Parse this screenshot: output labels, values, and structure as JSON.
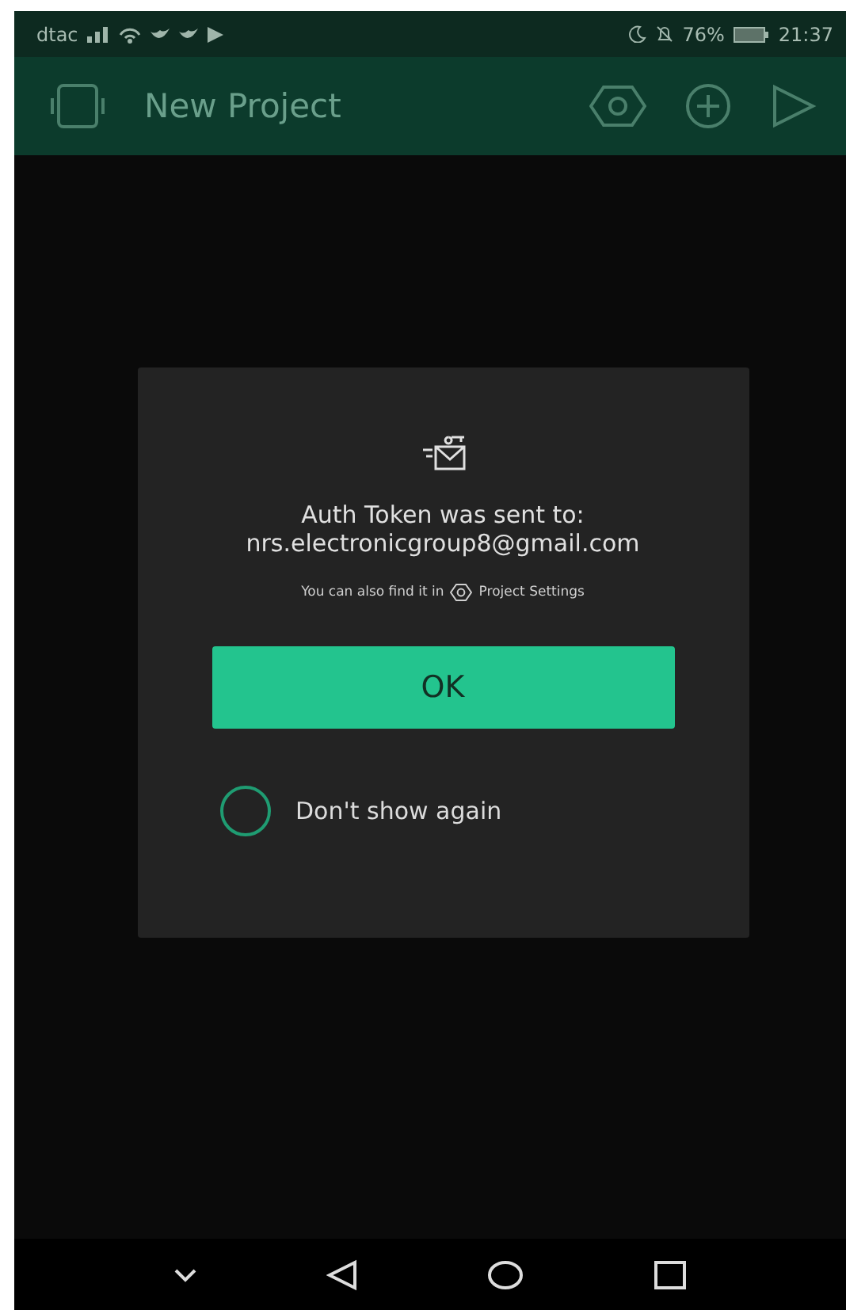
{
  "status_bar": {
    "carrier": "dtac",
    "battery": "76%",
    "time": "21:37"
  },
  "app_bar": {
    "title": "New Project"
  },
  "dialog": {
    "heading": "Auth Token was sent to:",
    "email": "nrs.electronicgroup8@gmail.com",
    "hint_before": "You can also find it in",
    "hint_after": "Project Settings",
    "ok_button": "OK",
    "dont_show_again": {
      "label": "Don't show again",
      "checked": false
    }
  }
}
